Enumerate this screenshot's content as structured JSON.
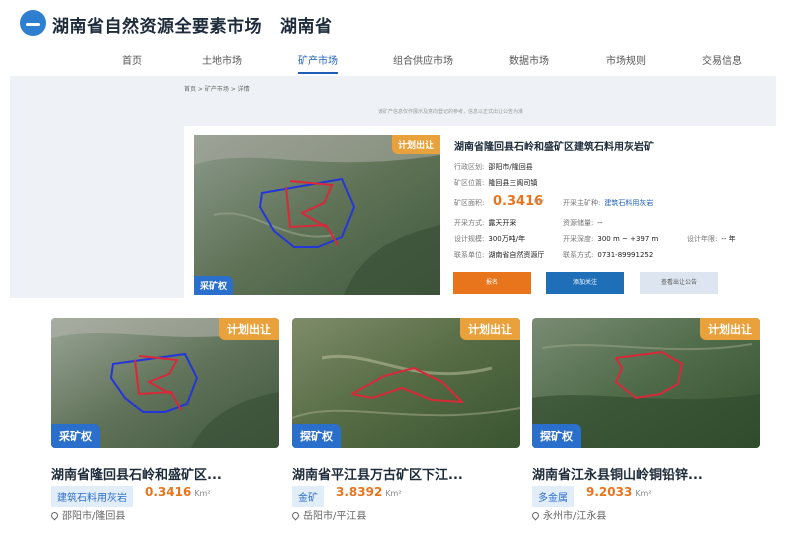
{
  "header": {
    "title": "湖南省自然资源全要素市场",
    "subtitle": "湖南省"
  },
  "nav": {
    "items": [
      "首页",
      "土地市场",
      "矿产市场",
      "组合供应市场",
      "数据市场",
      "市场规则",
      "交易信息"
    ],
    "active": "矿产市场"
  },
  "breadcrumb": "首页  >  矿产市场  >  详情",
  "notice": "该矿产信息仅作展示及意向登记的参考，信息以正式出让公告为准",
  "detail": {
    "title": "湖南省隆回县石岭和盛矿区建筑石料用灰岩矿",
    "plan_tag": "计划出让",
    "type_tag": "采矿权",
    "region_label": "行政区划:",
    "region_value": "邵阳市/隆回县",
    "location_label": "矿区位置:",
    "location_value": "隆回县三阁司镇",
    "area_label": "矿区面积:",
    "area_value": "0.3416",
    "area_unit": "Km²",
    "main_mineral_label": "开采主矿种:",
    "main_mineral_value": "建筑石料用灰岩",
    "method_label": "开采方式:",
    "method_value": "露天开采",
    "reserve_label": "资源储量:",
    "reserve_value": "--",
    "scale_label": "设计规模:",
    "scale_value": "300万吨/年",
    "depth_label": "开采深度:",
    "depth_value": "300 m ~ +397 m",
    "years_label": "设计年限:",
    "years_value": "-- 年",
    "unit_label": "联系单位:",
    "unit_value": "湖南省自然资源厅",
    "contact_label": "联系方式:",
    "contact_value": "0731-89991252",
    "btn_primary": "报名",
    "btn_follow": "添加关注",
    "btn_notice": "查看出让公告"
  },
  "cards": [
    {
      "title": "湖南省隆回县石岭和盛矿区...",
      "plan_tag": "计划出让",
      "type_tag": "采矿权",
      "mineral": "建筑石料用灰岩",
      "area": "0.3416",
      "unit": "Km²",
      "location": "邵阳市/隆回县"
    },
    {
      "title": "湖南省平江县万古矿区下江...",
      "plan_tag": "计划出让",
      "type_tag": "探矿权",
      "mineral": "金矿",
      "area": "3.8392",
      "unit": "Km²",
      "location": "岳阳市/平江县"
    },
    {
      "title": "湖南省江永县铜山岭铜铅锌...",
      "plan_tag": "计划出让",
      "type_tag": "探矿权",
      "mineral": "多金属",
      "area": "9.2033",
      "unit": "Km²",
      "location": "永州市/江永县"
    }
  ],
  "colors": {
    "accent_blue": "#1f5fb8",
    "accent_orange": "#e8741c",
    "plan_tag": "#e9a13b",
    "type_tag": "#2b6fcc"
  }
}
